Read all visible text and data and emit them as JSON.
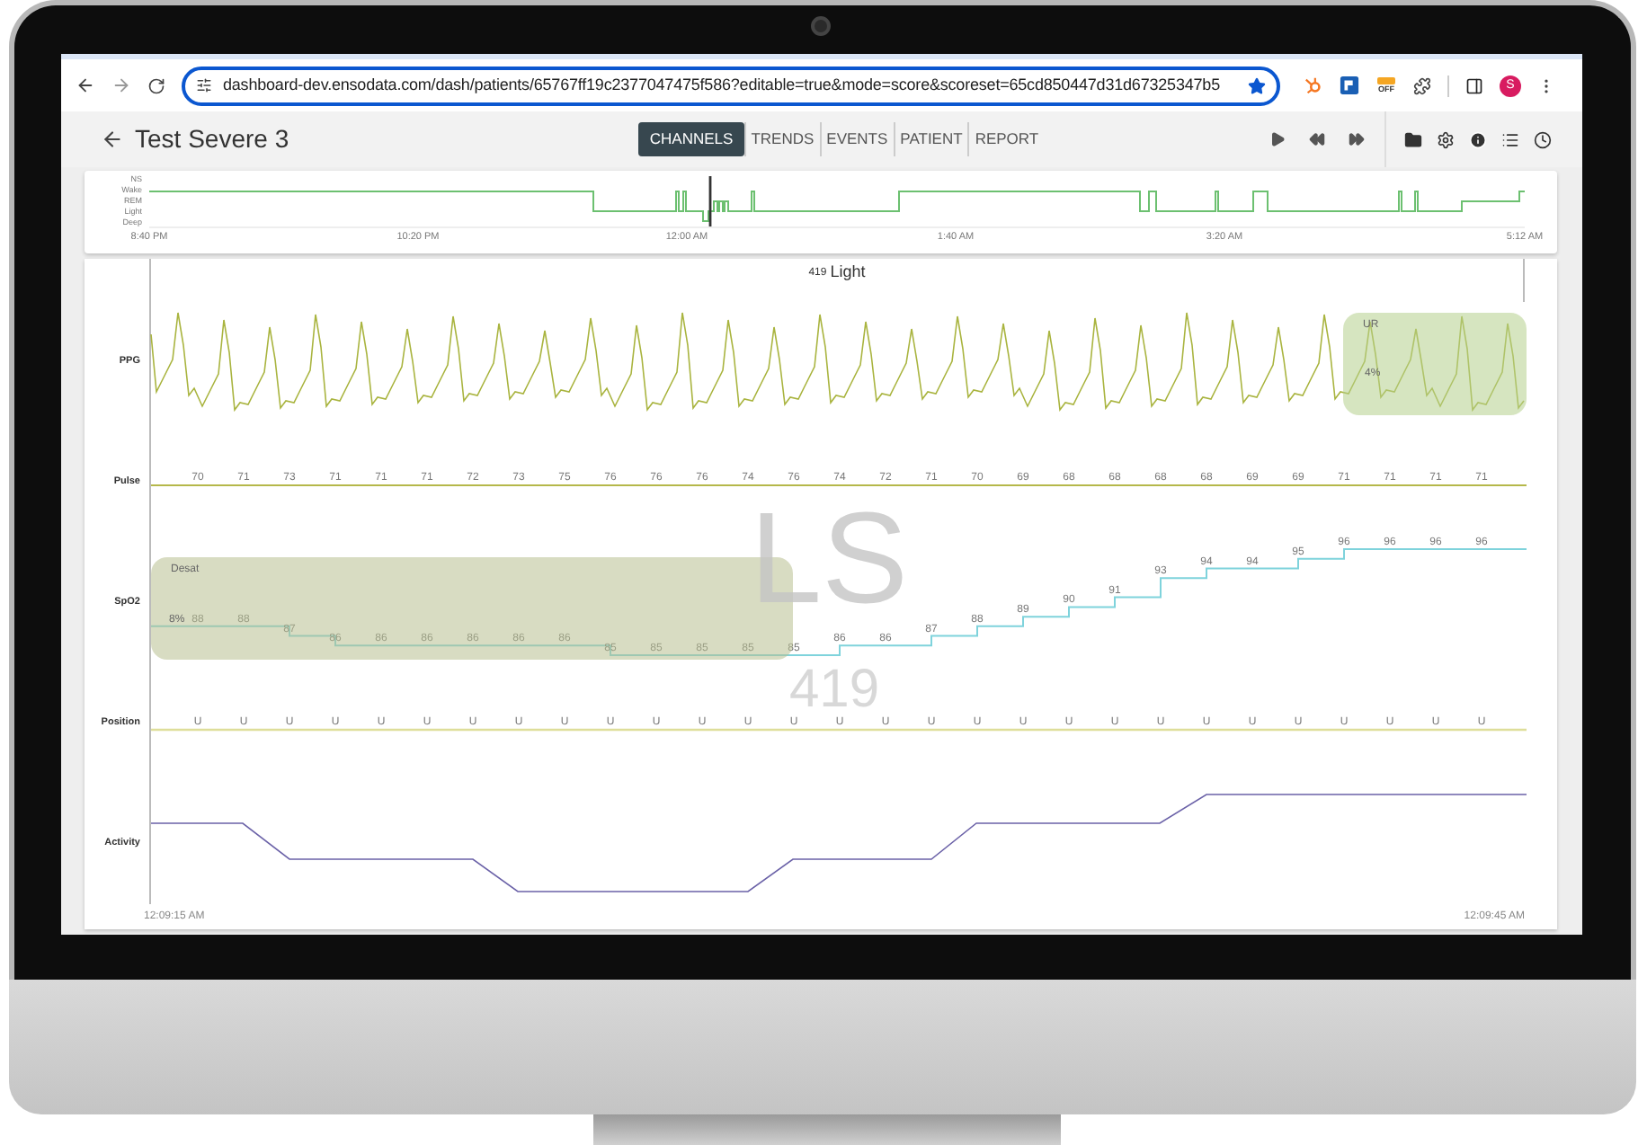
{
  "browser": {
    "url": "dashboard-dev.ensodata.com/dash/patients/65767ff19c2377047475f586?editable=true&mode=score&scoreset=65cd850447d31d67325347b5",
    "extension_badge": "OFF",
    "avatar": "S"
  },
  "header": {
    "title": "Test Severe 3",
    "tabs": [
      {
        "label": "CHANNELS",
        "selected": true
      },
      {
        "label": "TRENDS",
        "selected": false
      },
      {
        "label": "EVENTS",
        "selected": false
      },
      {
        "label": "PATIENT",
        "selected": false
      },
      {
        "label": "REPORT",
        "selected": false
      }
    ]
  },
  "hypnogram": {
    "stage_labels": [
      "NS",
      "Wake",
      "REM",
      "Light",
      "Deep"
    ],
    "time_labels": [
      "8:40 PM",
      "10:20 PM",
      "12:00 AM",
      "1:40 AM",
      "3:20 AM",
      "5:12 AM"
    ]
  },
  "epoch": {
    "number": "419",
    "stage": "Light"
  },
  "overlay": {
    "stage": "LS",
    "epoch": "419"
  },
  "channels": [
    {
      "kind": "waveform",
      "label": "PPG",
      "event": {
        "label": "UR",
        "value": "4%"
      }
    },
    {
      "kind": "numeric",
      "label": "Pulse",
      "values": [
        "70",
        "71",
        "73",
        "71",
        "71",
        "71",
        "72",
        "73",
        "75",
        "76",
        "76",
        "76",
        "74",
        "76",
        "74",
        "72",
        "71",
        "70",
        "69",
        "68",
        "68",
        "68",
        "68",
        "69",
        "69",
        "71",
        "71",
        "71",
        "71"
      ]
    },
    {
      "kind": "step",
      "label": "SpO2",
      "event": {
        "label": "Desat",
        "value": "8%"
      },
      "values": [
        "88",
        "88",
        "87",
        "86",
        "86",
        "86",
        "86",
        "86",
        "86",
        "85",
        "85",
        "85",
        "85",
        "85",
        "86",
        "86",
        "87",
        "88",
        "89",
        "90",
        "91",
        "93",
        "94",
        "94",
        "95",
        "96",
        "96",
        "96",
        "96"
      ]
    },
    {
      "kind": "categorical",
      "label": "Position",
      "values": [
        "U",
        "U",
        "U",
        "U",
        "U",
        "U",
        "U",
        "U",
        "U",
        "U",
        "U",
        "U",
        "U",
        "U",
        "U",
        "U",
        "U",
        "U",
        "U",
        "U",
        "U",
        "U",
        "U",
        "U",
        "U",
        "U",
        "U",
        "U",
        "U"
      ]
    },
    {
      "kind": "activity",
      "label": "Activity"
    }
  ],
  "time_labels": [
    "12:09:15 AM",
    "12:09:45 AM"
  ]
}
